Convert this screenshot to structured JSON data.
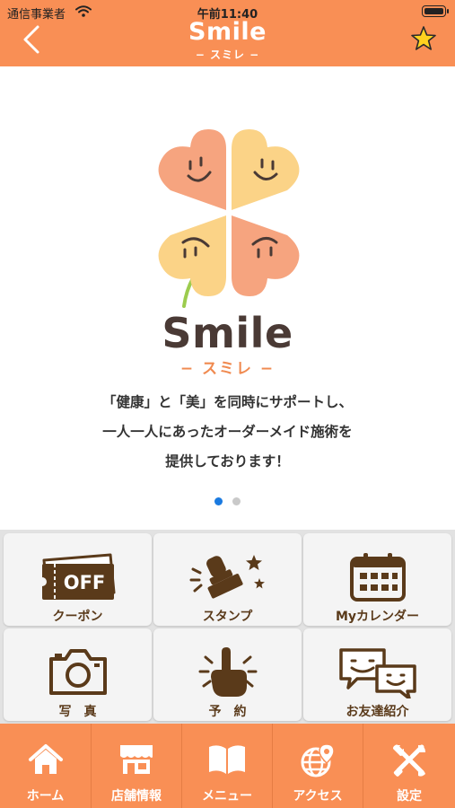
{
  "status_bar": {
    "carrier": "通信事業者",
    "time": "午前11:40"
  },
  "header": {
    "title": "Smile",
    "subtitle": "− スミレ −"
  },
  "hero": {
    "brand_name": "Smile",
    "brand_kana": "− スミレ −",
    "tagline": [
      "「健康」と「美」を同時にサポートし、",
      "一人一人にあったオーダーメイド施術を",
      "提供しております！"
    ],
    "pager": {
      "count": 2,
      "active": 1
    }
  },
  "menu": {
    "coupon": {
      "label": "クーポン",
      "icon": "coupon-ticket-icon",
      "badge": "OFF"
    },
    "stamp": {
      "label": "スタンプ",
      "icon": "stamp-icon"
    },
    "calendar": {
      "label": "Myカレンダー",
      "icon": "calendar-icon"
    },
    "photo": {
      "label": "写　真",
      "icon": "camera-icon"
    },
    "reservation": {
      "label": "予　約",
      "icon": "pointing-hand-icon"
    },
    "referral": {
      "label": "お友達紹介",
      "icon": "chat-bubbles-icon"
    }
  },
  "tabs": [
    {
      "label": "ホーム",
      "icon": "home-icon"
    },
    {
      "label": "店舗情報",
      "icon": "shop-icon"
    },
    {
      "label": "メニュー",
      "icon": "book-icon"
    },
    {
      "label": "アクセス",
      "icon": "globe-pin-icon"
    },
    {
      "label": "設定",
      "icon": "tools-icon"
    }
  ],
  "colors": {
    "brand_orange": "#f98f55",
    "icon_brown": "#5a3a1a",
    "petal_salmon": "#f6a47f",
    "petal_yellow": "#fbd387",
    "stem_green": "#9ccc4e",
    "pager_active": "#1a7ae0",
    "pager_inactive": "#c9c9c9"
  }
}
